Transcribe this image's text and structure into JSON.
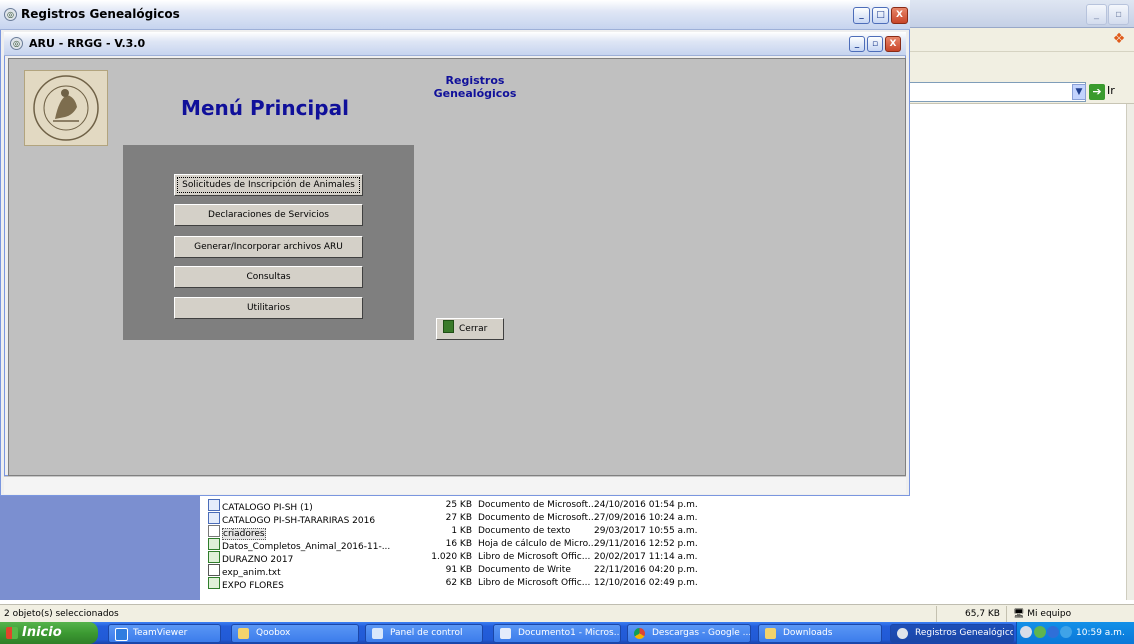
{
  "outer_window": {
    "title": "Registros Genealógicos",
    "minimize": "_",
    "maximize": "□",
    "close": "X"
  },
  "inner_window": {
    "title": "ARU - RRGG - V.3.0",
    "minimize": "_",
    "restore": "▫",
    "close": "X"
  },
  "form": {
    "menu_title": "Menú Principal",
    "header_line1": "Registros",
    "header_line2": "Genealógicos",
    "buttons": [
      "Solicitudes de Inscripción de Animales",
      "Declaraciones de Servicios",
      "Generar/Incorporar archivos ARU",
      "Consultas",
      "Utilitarios"
    ],
    "close_button": "Cerrar"
  },
  "background_explorer": {
    "go_label": "Ir",
    "files": [
      {
        "name": "CATALOGO PI-SH (1)",
        "size": "25 KB",
        "type": "Documento de Microsoft...",
        "date": "24/10/2016 01:54 p.m."
      },
      {
        "name": "CATALOGO PI-SH-TARARIRAS 2016",
        "size": "27 KB",
        "type": "Documento de Microsoft...",
        "date": "27/09/2016 10:24 a.m."
      },
      {
        "name": "criadores",
        "size": "1 KB",
        "type": "Documento de texto",
        "date": "29/03/2017 10:55 a.m."
      },
      {
        "name": "Datos_Completos_Animal_2016-11-...",
        "size": "16 KB",
        "type": "Hoja de cálculo de Micro...",
        "date": "29/11/2016 12:52 p.m."
      },
      {
        "name": "DURAZNO 2017",
        "size": "1.020 KB",
        "type": "Libro de Microsoft Offic...",
        "date": "20/02/2017 11:14 a.m."
      },
      {
        "name": "exp_anim.txt",
        "size": "91 KB",
        "type": "Documento de Write",
        "date": "22/11/2016 04:20 p.m."
      },
      {
        "name": "EXPO FLORES",
        "size": "62 KB",
        "type": "Libro de Microsoft Offic...",
        "date": "12/10/2016 02:49 p.m."
      }
    ],
    "status_left": "2 objeto(s) seleccionados",
    "status_size": "65,7 KB",
    "status_location": "Mi equipo"
  },
  "taskbar": {
    "start_label": "Inicio",
    "items": [
      "TeamViewer",
      "Qoobox",
      "Panel de control",
      "Documento1 - Micros...",
      "Descargas - Google ...",
      "Downloads",
      "Registros Genealógicos"
    ],
    "clock": "10:59 a.m."
  }
}
